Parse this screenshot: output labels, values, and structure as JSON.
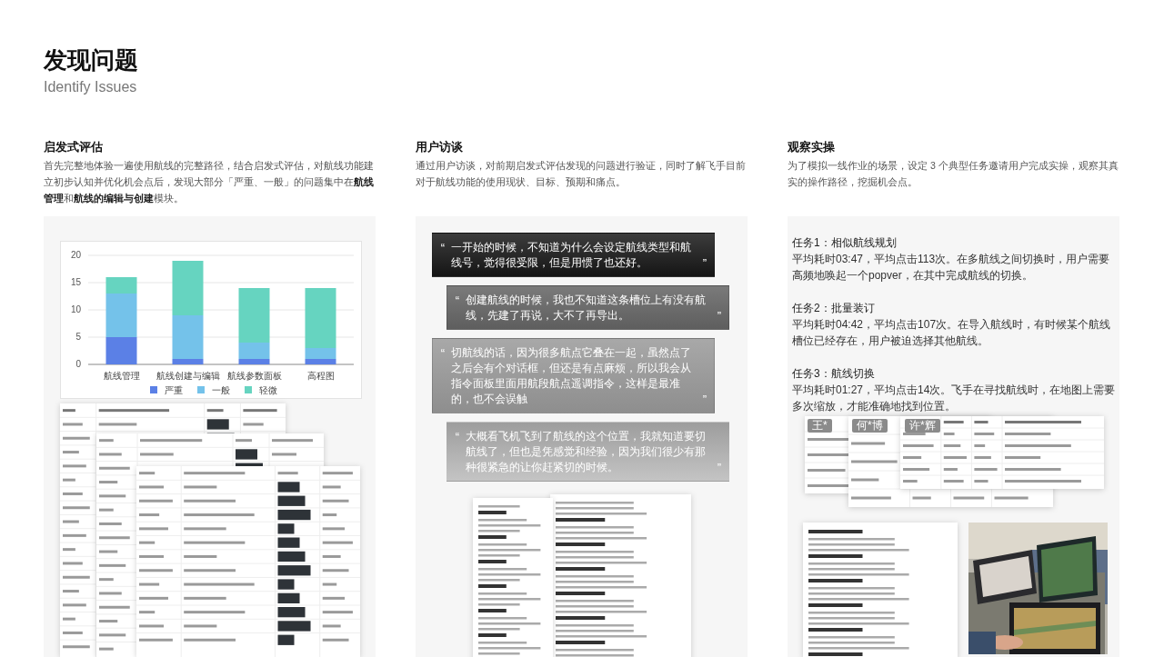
{
  "page": {
    "title": "发现问题",
    "subtitle": "Identify Issues"
  },
  "sections": [
    {
      "kind": "heuristic",
      "heading": "启发式评估",
      "body": "首先完整地体验一遍使用航线的完整路径，结合启发式评估，对航线功能建立初步认知并优化机会点后，发现大部分「严重、一般」的问题集中在**航线管理**和**航线的编辑与创建**模块。",
      "chart_data": {
        "type": "bar",
        "stacked": true,
        "grid": true,
        "legend": true,
        "categories": [
          "航线管理",
          "航线创建与编辑",
          "航线参数面板",
          "高程图"
        ],
        "ylim": [
          0,
          20
        ],
        "yticks": [
          0,
          5,
          10,
          15,
          20
        ],
        "series": [
          {
            "name": "严重",
            "color": "#5b80e6",
            "values": [
              5,
              1,
              1,
              1
            ]
          },
          {
            "name": "一般",
            "color": "#74c2ea",
            "values": [
              8,
              8,
              3,
              2
            ]
          },
          {
            "name": "轻微",
            "color": "#66d4c0",
            "values": [
              3,
              10,
              10,
              11
            ]
          }
        ]
      }
    },
    {
      "kind": "interview",
      "heading": "用户访谈",
      "body": "通过用户访谈，对前期启发式评估发现的问题进行验证，同时了解飞手目前对于航线功能的使用现状、目标、预期和痛点。",
      "quotes": [
        {
          "open_mark": "“",
          "text": "一开始的时候，不知道为什么会设定航线类型和航线号，觉得很受限，但是用惯了也还好。",
          "close_mark": "”"
        },
        {
          "open_mark": "“",
          "text": "创建航线的时候，我也不知道这条槽位上有没有航线，先建了再说，大不了再导出。",
          "close_mark": "”"
        },
        {
          "open_mark": "“",
          "text": "切航线的话，因为很多航点它叠在一起，虽然点了之后会有个对话框，但还是有点麻烦，所以我会从指令面板里面用航段航点遥调指令，这样是最准的，也不会误触",
          "close_mark": "”"
        },
        {
          "open_mark": "“",
          "text": "大概看飞机飞到了航线的这个位置，我就知道要切航线了，但也是凭感觉和经验，因为我们很少有那种很紧急的让你赶紧切的时候。",
          "close_mark": "”"
        }
      ]
    },
    {
      "kind": "observation",
      "heading": "观察实操",
      "body": "为了模拟一线作业的场景，设定 3 个典型任务邀请用户完成实操，观察其真实的操作路径，挖掘机会点。",
      "tasks": [
        {
          "title": "任务1：相似航线规划",
          "body": "平均耗时03:47，平均点击113次。在多航线之间切换时，用户需要高频地唤起一个popver，在其中完成航线的切换。"
        },
        {
          "title": "任务2：批量装订",
          "body": "平均耗时04:42，平均点击107次。在导入航线时，有时候某个航线槽位已经存在，用户被迫选择其他航线。"
        },
        {
          "title": "任务3：航线切换",
          "body": "平均耗时01:27，平均点击14次。飞手在寻找航线时，在地图上需要多次缩放，才能准确地找到位置。"
        }
      ],
      "participants": [
        "王*",
        "何*博",
        "许*辉"
      ]
    }
  ]
}
